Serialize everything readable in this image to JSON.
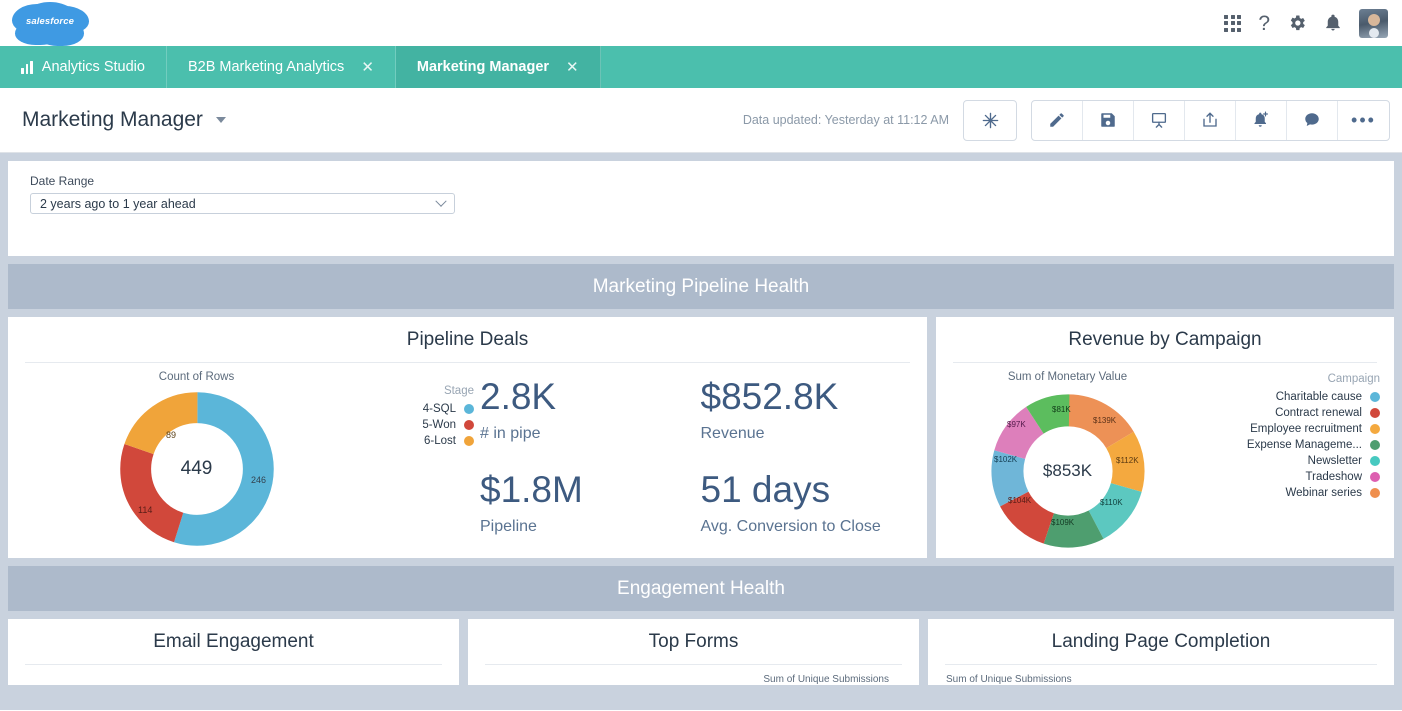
{
  "brand": {
    "logo_text": "salesforce",
    "logo_color": "#3f9ae3"
  },
  "header": {
    "icons": [
      {
        "name": "app-launcher-icon",
        "glyph": "grid"
      },
      {
        "name": "help-icon",
        "glyph": "?"
      },
      {
        "name": "setup-gear-icon",
        "glyph": "gear"
      },
      {
        "name": "notifications-bell-icon",
        "glyph": "bell"
      },
      {
        "name": "user-avatar",
        "glyph": "avatar"
      }
    ]
  },
  "tabs": [
    {
      "label": "Analytics Studio",
      "icon": "bar-chart-icon",
      "active": false,
      "closable": false
    },
    {
      "label": "B2B Marketing Analytics",
      "active": false,
      "closable": true,
      "close_label": "✕"
    },
    {
      "label": "Marketing Manager",
      "active": true,
      "closable": true,
      "close_label": "✕"
    }
  ],
  "dashboard": {
    "title": "Marketing Manager",
    "data_updated": "Data updated: Yesterday at 11:12 AM",
    "toolbar_buttons": [
      {
        "name": "einstein-sparkle-button",
        "label": "Einstein",
        "group": "single"
      },
      {
        "name": "edit-pencil-button",
        "label": "Edit"
      },
      {
        "name": "save-button",
        "label": "Save"
      },
      {
        "name": "presentation-button",
        "label": "Present"
      },
      {
        "name": "share-button",
        "label": "Share"
      },
      {
        "name": "subscribe-button",
        "label": "Subscribe"
      },
      {
        "name": "conversation-button",
        "label": "Chatter"
      },
      {
        "name": "more-actions-button",
        "label": "•••"
      }
    ]
  },
  "filter": {
    "label": "Date Range",
    "value": "2 years ago to 1 year ahead"
  },
  "sections": [
    {
      "title": "Marketing Pipeline Health"
    },
    {
      "title": "Engagement Health"
    }
  ],
  "cards": {
    "pipeline_deals": {
      "title": "Pipeline Deals"
    },
    "revenue_by_campaign": {
      "title": "Revenue by Campaign"
    },
    "email_engagement": {
      "title": "Email Engagement"
    },
    "top_forms": {
      "title": "Top Forms",
      "subtitle": "Sum of Unique Submissions"
    },
    "landing_page_completion": {
      "title": "Landing Page Completion",
      "subtitle": "Sum of Unique Submissions"
    }
  },
  "kpis": [
    {
      "value": "2.8K",
      "label": "# in pipe"
    },
    {
      "value": "$852.8K",
      "label": "Revenue"
    },
    {
      "value": "$1.8M",
      "label": "Pipeline"
    },
    {
      "value": "51 days",
      "label": "Avg. Conversion to Close"
    }
  ],
  "chart_data": [
    {
      "type": "pie",
      "title": "Pipeline Deals",
      "subtitle": "Count of Rows",
      "legend_title": "Stage",
      "legend_position": "right",
      "center_label": "449",
      "total": 449,
      "categories": [
        "4-SQL",
        "5-Won",
        "6-Lost"
      ],
      "values": [
        246,
        114,
        89
      ],
      "data_labels": [
        "246",
        "114",
        "89"
      ],
      "colors": [
        "#5bb6d9",
        "#d1483b",
        "#f0a43a"
      ]
    },
    {
      "type": "pie",
      "title": "Revenue by Campaign",
      "subtitle": "Sum of Monetary Value",
      "legend_title": "Campaign",
      "legend_position": "right",
      "center_label": "$853K",
      "total": 853,
      "categories": [
        "$139K",
        "$112K",
        "$110K",
        "$109K",
        "$104K",
        "$102K",
        "$97K",
        "$81K"
      ],
      "values": [
        139,
        112,
        110,
        109,
        104,
        102,
        97,
        81
      ],
      "data_labels": [
        "$139K",
        "$112K",
        "$110K",
        "$109K",
        "$104K",
        "$102K",
        "$97K",
        "$81K"
      ],
      "colors": [
        "#ed9156",
        "#f4a93f",
        "#5cc8c0",
        "#4e9e6f",
        "#d1483b",
        "#6fb6d8",
        "#dd7fbb",
        "#5cbd5e"
      ],
      "legend_entries": [
        {
          "label": "Charitable cause",
          "color": "#5bb6d9"
        },
        {
          "label": "Contract renewal",
          "color": "#d1483b"
        },
        {
          "label": "Employee recruitment",
          "color": "#f4a93f"
        },
        {
          "label": "Expense Manageme...",
          "color": "#4e9e6f"
        },
        {
          "label": "Newsletter",
          "color": "#47c9c0"
        },
        {
          "label": "Tradeshow",
          "color": "#dd5fb0"
        },
        {
          "label": "Webinar series",
          "color": "#ef8f4e"
        }
      ]
    }
  ]
}
